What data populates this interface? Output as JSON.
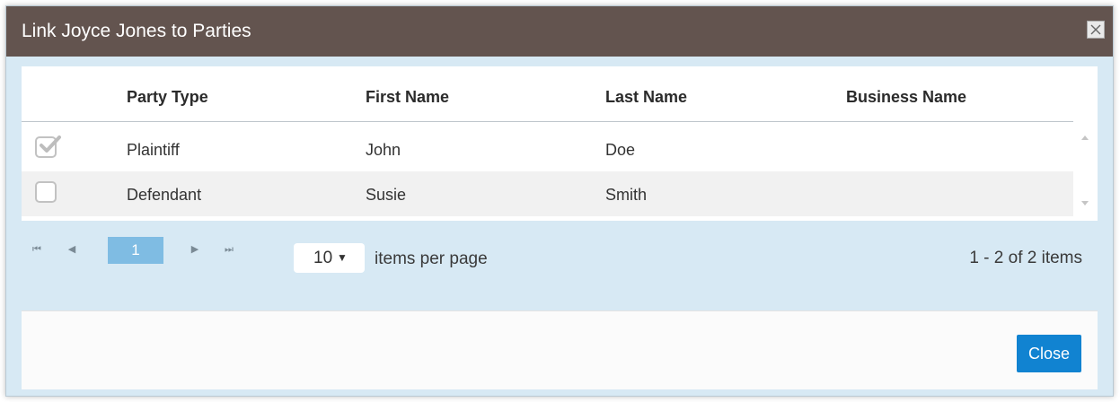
{
  "dialog": {
    "title": "Link Joyce Jones to Parties",
    "close_icon": "close-x-icon"
  },
  "grid": {
    "columns": [
      "Party Type",
      "First Name",
      "Last Name",
      "Business Name"
    ],
    "rows": [
      {
        "checked": true,
        "party_type": "Plaintiff",
        "first_name": "John",
        "last_name": "Doe",
        "business_name": ""
      },
      {
        "checked": false,
        "party_type": "Defendant",
        "first_name": "Susie",
        "last_name": "Smith",
        "business_name": ""
      }
    ]
  },
  "pager": {
    "first_icon": "⏮",
    "prev_icon": "◀",
    "current_page": "1",
    "next_icon": "▶",
    "last_icon": "⏭",
    "page_size": "10",
    "page_size_caret": "▼",
    "items_per_page_label": "items per page",
    "info": "1 - 2 of 2 items"
  },
  "footer": {
    "close_label": "Close"
  },
  "colors": {
    "titlebar": "#63544f",
    "accent": "#1183d1",
    "current_page": "#7fbce3",
    "dialog_bg": "#d7e9f4"
  }
}
